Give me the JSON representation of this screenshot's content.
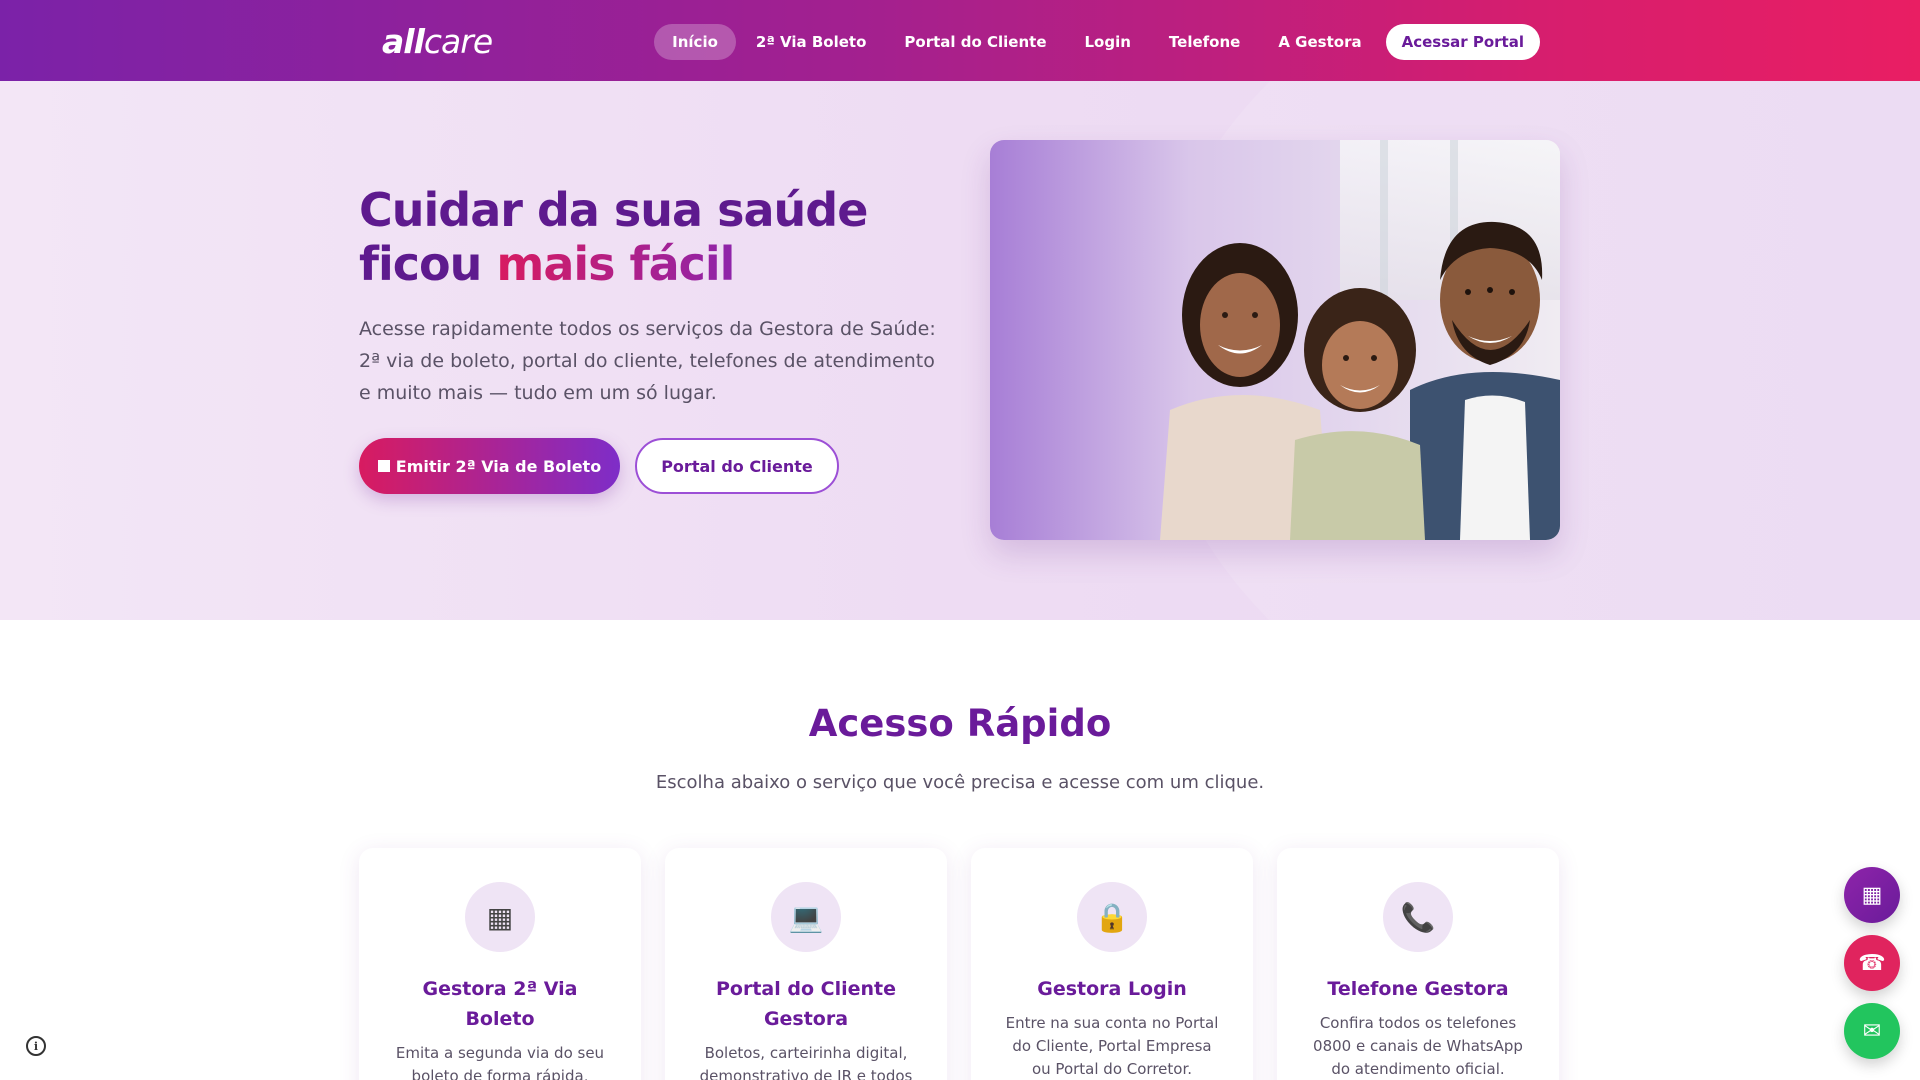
{
  "header": {
    "logo_bold": "all",
    "logo_light": "care",
    "nav": [
      {
        "label": "Início",
        "active": true
      },
      {
        "label": "2ª Via Boleto"
      },
      {
        "label": "Portal do Cliente"
      },
      {
        "label": "Login"
      },
      {
        "label": "Telefone"
      },
      {
        "label": "A Gestora"
      }
    ],
    "cta_label": "Acessar Portal"
  },
  "hero": {
    "title_line1": "Cuidar da sua saúde",
    "title_line2_plain": "ficou ",
    "title_line2_accent": "mais fácil",
    "subtitle": "Acesse rapidamente todos os serviços da Gestora de Saúde: 2ª via de boleto, portal do cliente, telefones de atendimento e muito mais — tudo em um só lugar.",
    "primary_button": "Emitir 2ª Via de Boleto",
    "secondary_button": "Portal do Cliente",
    "image_icon": "family-photo"
  },
  "quick_access": {
    "title": "Acesso Rápido",
    "subtitle": "Escolha abaixo o serviço que você precisa e acesse com um clique.",
    "cards": [
      {
        "icon": "▦",
        "icon_name": "barcode-icon",
        "title": "Gestora 2ª Via Boleto",
        "text": "Emita a segunda via do seu boleto de forma rápida, gratuita e sem senha."
      },
      {
        "icon": "💻",
        "icon_name": "laptop-icon",
        "title": "Portal do Cliente Gestora",
        "text": "Boletos, carteirinha digital, demonstrativo de IR e todos"
      },
      {
        "icon": "🔒",
        "icon_name": "lock-icon",
        "title": "Gestora Login",
        "text": "Entre na sua conta no Portal do Cliente, Portal Empresa ou Portal do Corretor."
      },
      {
        "icon": "📞",
        "icon_name": "phone-icon",
        "title": "Telefone Gestora",
        "text": "Confira todos os telefones 0800 e canais de WhatsApp do atendimento oficial."
      }
    ]
  },
  "floating": {
    "boleto_icon": "▦",
    "phone_icon": "☎",
    "mail_icon": "✉",
    "info_icon": "i"
  },
  "colors": {
    "brand_purple": "#6a1b9a",
    "brand_pink": "#e91e63",
    "whatsapp_green": "#22c55e"
  }
}
